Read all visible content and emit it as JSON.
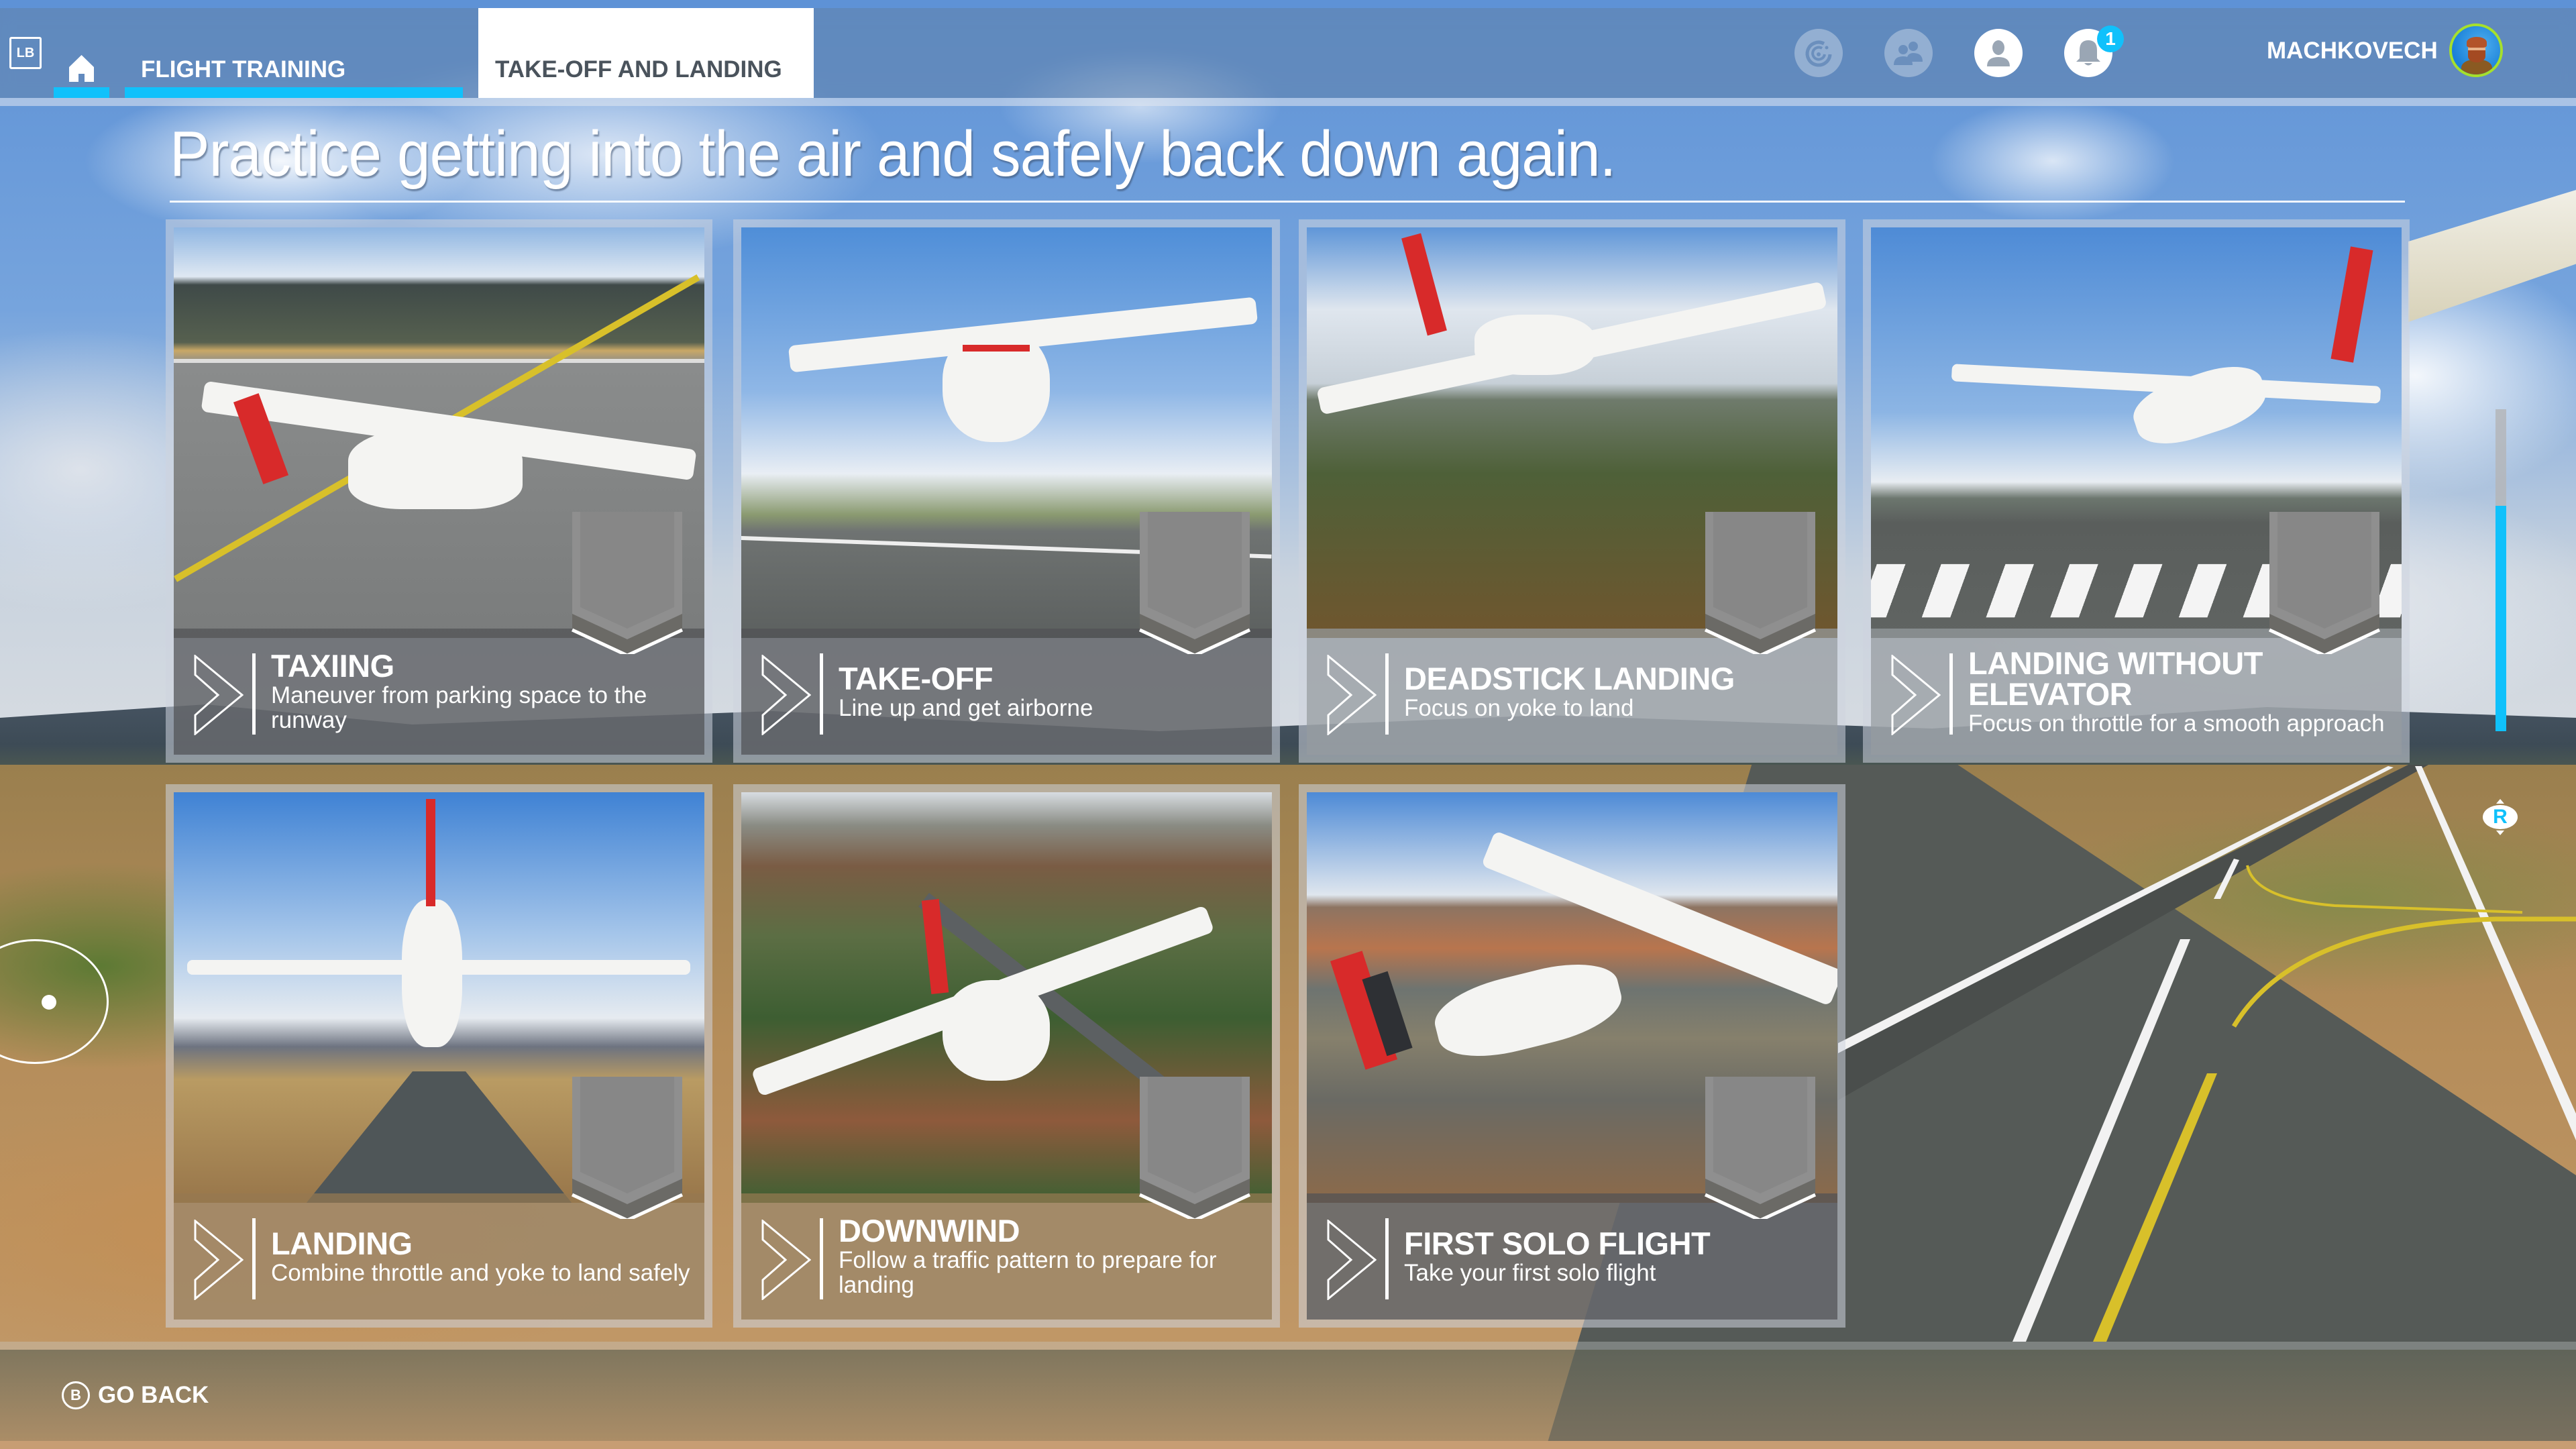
{
  "header": {
    "lb_label": "LB",
    "home_icon": "home-icon",
    "tabs": [
      {
        "label": "FLIGHT TRAINING",
        "active": false
      },
      {
        "label": "TAKE-OFF AND LANDING",
        "active": true
      }
    ],
    "icons": [
      {
        "name": "activity-feed-icon",
        "state": "dim"
      },
      {
        "name": "friends-icon",
        "state": "dim"
      },
      {
        "name": "profile-icon",
        "state": "lit"
      },
      {
        "name": "notifications-icon",
        "state": "lit",
        "badge": "1"
      }
    ],
    "username": "MACHKOVECH",
    "accent_color": "#10c1fb",
    "avatar_ring_color": "#a6e02c"
  },
  "page": {
    "title": "Practice getting into the air and safely back down again."
  },
  "cards": [
    {
      "title": "TAXIING",
      "description": "Maneuver from parking space to the runway"
    },
    {
      "title": "TAKE-OFF",
      "description": "Line up and get airborne"
    },
    {
      "title": "DEADSTICK LANDING",
      "description": "Focus on yoke to land"
    },
    {
      "title": "LANDING WITHOUT ELEVATOR",
      "description": "Focus on throttle for a smooth approach"
    },
    {
      "title": "LANDING",
      "description": "Combine throttle and yoke to land safely"
    },
    {
      "title": "DOWNWIND",
      "description": "Follow a traffic pattern to prepare for landing"
    },
    {
      "title": "FIRST SOLO FLIGHT",
      "description": "Take your first solo flight"
    }
  ],
  "scroll": {
    "knob_label": "R",
    "fill_fraction": 0.7
  },
  "footer": {
    "button_glyph": "B",
    "go_back_label": "GO BACK"
  }
}
